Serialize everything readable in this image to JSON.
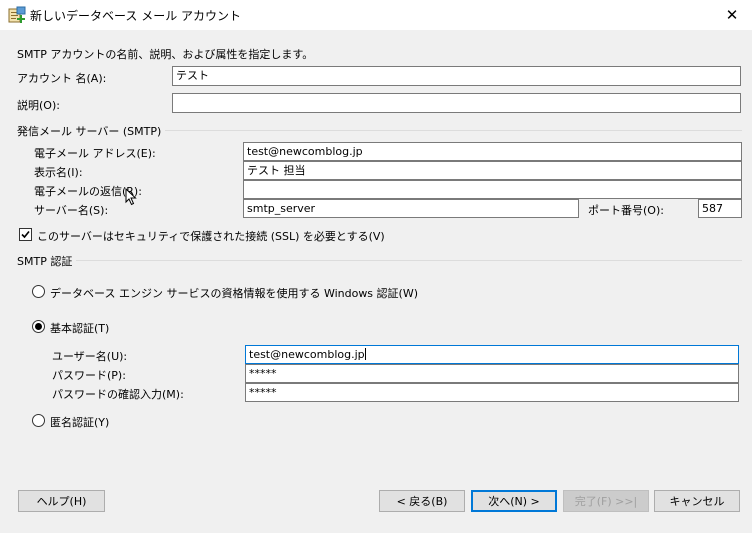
{
  "window": {
    "title": "新しいデータベース メール アカウント",
    "close_glyph": "✕"
  },
  "intro": "SMTP アカウントの名前、説明、および属性を指定します。",
  "account": {
    "name_label": "アカウント 名(A):",
    "name_value": "テスト",
    "desc_label": "説明(O):",
    "desc_value": ""
  },
  "smtp_server": {
    "group_title": "発信メール サーバー (SMTP)",
    "email_label": "電子メール アドレス(E):",
    "email_value": "test@newcomblog.jp",
    "display_label": "表示名(I):",
    "display_value": "テスト 担当",
    "reply_label": "電子メールの返信(R):",
    "reply_value": "",
    "server_label": "サーバー名(S):",
    "server_value": "smtp_server",
    "port_label": "ポート番号(O):",
    "port_value": "587",
    "ssl_label": "このサーバーはセキュリティで保護された接続 (SSL) を必要とする(V)",
    "ssl_checked": true
  },
  "smtp_auth": {
    "group_title": "SMTP 認証",
    "windows_auth_label": "データベース エンジン サービスの資格情報を使用する Windows 認証(W)",
    "basic_auth_label": "基本認証(T)",
    "selected": "basic",
    "username_label": "ユーザー名(U):",
    "username_value": "test@newcomblog.jp",
    "password_label": "パスワード(P):",
    "password_value": "*****",
    "confirm_label": "パスワードの確認入力(M):",
    "confirm_value": "*****",
    "anonymous_label": "匿名認証(Y)"
  },
  "buttons": {
    "help": "ヘルプ(H)",
    "back": "< 戻る(B)",
    "next": "次へ(N) >",
    "finish": "完了(F) >>|",
    "cancel": "キャンセル"
  },
  "colors": {
    "focus_border": "#0078d7",
    "dialog_bg": "#f0f0f0"
  }
}
